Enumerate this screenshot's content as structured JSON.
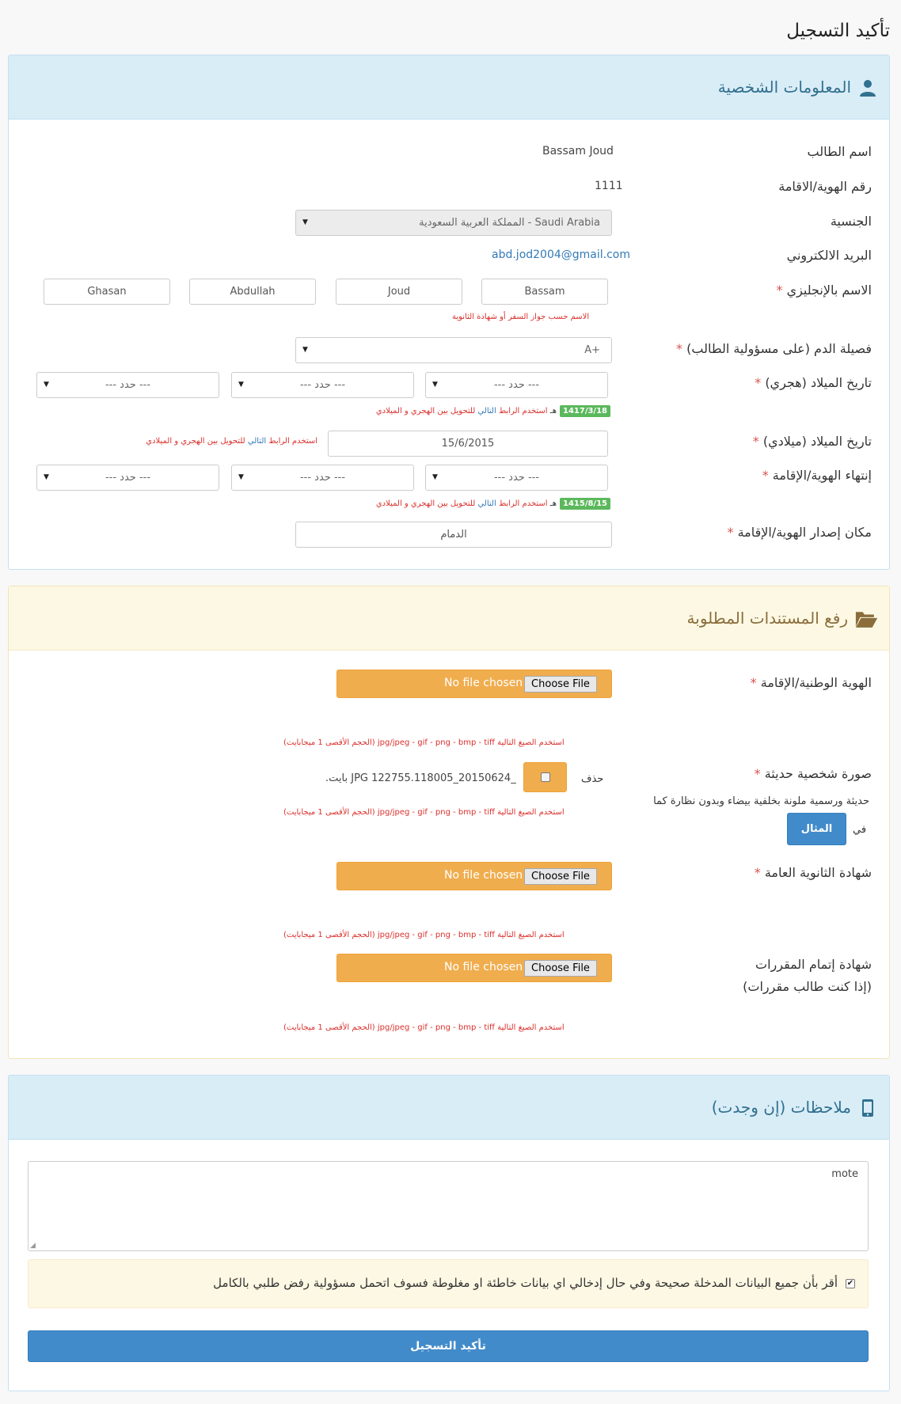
{
  "page_title": "تأكيد التسجيل",
  "personal": {
    "heading": "المعلومات الشخصية",
    "student_name_label": "اسم الطالب",
    "student_name": "Bassam Joud",
    "id_label": "رقم الهوية/الاقامة",
    "id_value": "1111",
    "nationality_label": "الجنسية",
    "nationality_value": "Saudi Arabia - المملكة العربية السعودية",
    "email_label": "البريد الالكتروني",
    "email_value": "abd.jod2004@gmail.com",
    "english_name_label": "الاسم بالإنجليزي",
    "english_name_parts": [
      "Bassam",
      "Joud",
      "Abdullah",
      "Ghasan"
    ],
    "english_name_hint": "الاسم حسب جواز السفر أو شهادة الثانوية",
    "blood_label": "فصيلة الدم (على مسؤولية الطالب)",
    "blood_value": "A+",
    "hijri_dob_label": "تاريخ الميلاد (هجري)",
    "select_placeholder": "--- حدد ---",
    "hijri_dob_badge": "1417/3/18",
    "hijri_suffix": "هـ",
    "convert_hint_pre": "استخدم الرابط",
    "convert_hint_link": "التالي",
    "convert_hint_post": "للتحويل بين الهجري و الميلادي",
    "greg_dob_label": "تاريخ الميلاد (ميلادي)",
    "greg_dob_value": "15/6/2015",
    "id_expiry_label": "إنتهاء الهوية/الإقامة",
    "id_expiry_badge": "1415/8/15",
    "issue_place_label": "مكان إصدار الهوية/الإقامة",
    "issue_place_value": "الدمام",
    "required_mark": "*"
  },
  "documents": {
    "heading": "رفع المستندات المطلوبة",
    "no_file": "No file chosen",
    "choose_file": "Choose File",
    "formats_hint": "استخدم الصيغ التالية jpg/jpeg - gif - png - bmp - tiff (الحجم الأقصى 1 ميجابايت)",
    "national_id_label": "الهوية الوطنية/الإقامة",
    "photo_label": "صورة شخصية حديثة",
    "photo_delete_label": "حذف",
    "photo_file_info": "_20150624_122755.118005 JPG بايت.",
    "photo_desc": "حديثة ورسمية ملونة بخلفية بيضاء وبدون نظارة كما",
    "photo_in": "في",
    "example_button": "المثال",
    "highschool_label": "شهادة الثانوية العامة",
    "courses_label_1": "شهادة إتمام المقررات",
    "courses_label_2": "(إذا كنت طالب مقررات)"
  },
  "notes": {
    "heading": "ملاحظات (إن وجدت)",
    "textarea_value": "mote",
    "agreement_text": "أقر بأن جميع البيانات المدخلة صحيحة وفي حال إدخالي اي بيانات خاطئة او مغلوطة فسوف اتحمل مسؤولية رفض طلبي بالكامل",
    "agreement_checked": true,
    "submit_label": "تأكيد التسجيل"
  },
  "colors": {
    "info_bg": "#d9edf7",
    "info_text": "#31708f",
    "warning_bg": "#fcf8e3",
    "warning_text": "#8a6d3b",
    "file_button": "#f0ad4e",
    "primary": "#428bca",
    "danger": "#d9534f",
    "success": "#5cb85c"
  }
}
